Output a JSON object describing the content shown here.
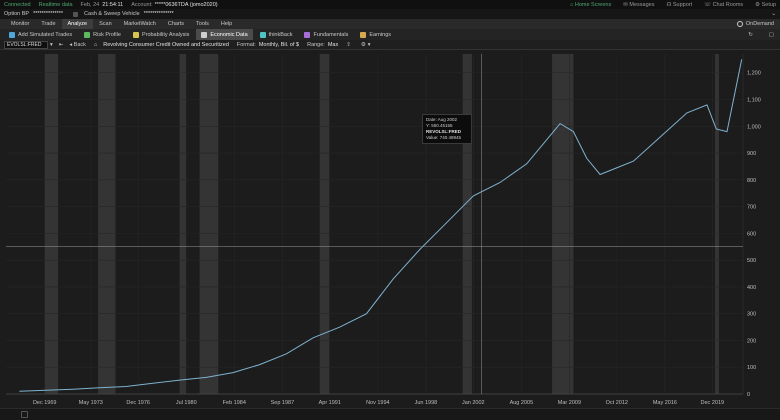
{
  "status_bar": {
    "connected": "Connected",
    "realtime": "Realtime data",
    "date": "Feb, 24",
    "time": "21:54:11",
    "account_label": "Account:",
    "account_value": "*****0636TDA (jomo2020)",
    "home_screens": "Home Screens",
    "messages": "Messages",
    "support": "Support",
    "chat_rooms": "Chat Rooms",
    "setup": "Setup"
  },
  "balance_bar": {
    "option_bp": "Option BP",
    "option_bp_value": "**************",
    "cash_sweep": "Cash & Sweep Vehicle",
    "cash_sweep_value": "**************"
  },
  "main_tabs": [
    "Monitor",
    "Trade",
    "Analyze",
    "Scan",
    "MarketWatch",
    "Charts",
    "Tools",
    "Help"
  ],
  "active_main_tab": 2,
  "ondemand": "OnDemand",
  "sub_tabs": [
    {
      "label": "Add Simulated Trades",
      "icon": "plus-icon",
      "color": "#4fa6d8"
    },
    {
      "label": "Risk Profile",
      "icon": "risk-profile-icon",
      "color": "#5fb85f"
    },
    {
      "label": "Probability Analysis",
      "icon": "probability-icon",
      "color": "#d8c44f"
    },
    {
      "label": "Economic Data",
      "icon": "economic-data-icon",
      "color": "#cfcfcf"
    },
    {
      "label": "thinkBack",
      "icon": "thinkback-icon",
      "color": "#4fc2c2"
    },
    {
      "label": "Fundamentals",
      "icon": "fundamentals-icon",
      "color": "#a66fd8"
    },
    {
      "label": "Earnings",
      "icon": "earnings-icon",
      "color": "#d8a84f"
    }
  ],
  "active_sub_tab": 3,
  "chart_toolbar": {
    "symbol": "EVOLSL:FRED",
    "back": "Back",
    "title": "Revolving Consumer Credit Owned and Securitized",
    "format_label": "Format:",
    "format_value": "Monthly, Bil. of $",
    "range_label": "Range:",
    "range_value": "Max"
  },
  "tooltip": {
    "date_label": "Date:",
    "date_value": "Aug 2002",
    "y_label": "Y:",
    "y_value": "550.45155",
    "series": "REVOLSL:FRED",
    "value_label": "Value:",
    "value_value": "740.48945"
  },
  "chart_data": {
    "type": "line",
    "x_tick_labels": [
      "Dec 1969",
      "May 1973",
      "Dec 1976",
      "Jul 1980",
      "Feb 1984",
      "Sep 1987",
      "Apr 1991",
      "Nov 1994",
      "Jun 1998",
      "Jan 2002",
      "Aug 2005",
      "Mar 2009",
      "Oct 2012",
      "May 2016",
      "Dec 2019"
    ],
    "x_tick_years": [
      1969.9,
      1973.35,
      1976.9,
      1980.5,
      1984.1,
      1987.7,
      1991.25,
      1994.85,
      1998.45,
      2002.0,
      2005.6,
      2009.2,
      2012.75,
      2016.35,
      2019.9
    ],
    "y_ticks": [
      0,
      100,
      200,
      300,
      400,
      500,
      600,
      700,
      800,
      900,
      1000,
      1100,
      1200
    ],
    "y_tick_labels": [
      "0",
      "100",
      "200",
      "300",
      "400",
      "500",
      "600",
      "700",
      "800",
      "900",
      "1,000",
      "1,100",
      "1,200"
    ],
    "xlim": [
      1967.0,
      2022.2
    ],
    "ylim": [
      0,
      1270
    ],
    "series_color": "#7fb2cf",
    "points": [
      [
        1968.0,
        10
      ],
      [
        1970,
        14
      ],
      [
        1972,
        18
      ],
      [
        1974,
        23
      ],
      [
        1976,
        28
      ],
      [
        1978,
        40
      ],
      [
        1980,
        52
      ],
      [
        1982,
        62
      ],
      [
        1984,
        80
      ],
      [
        1986,
        110
      ],
      [
        1988,
        150
      ],
      [
        1990,
        210
      ],
      [
        1992,
        250
      ],
      [
        1994,
        300
      ],
      [
        1996,
        430
      ],
      [
        1998,
        540
      ],
      [
        2000,
        640
      ],
      [
        2002,
        740
      ],
      [
        2004,
        790
      ],
      [
        2006,
        860
      ],
      [
        2007,
        920
      ],
      [
        2008.5,
        1010
      ],
      [
        2009.5,
        980
      ],
      [
        2010.5,
        880
      ],
      [
        2011.5,
        820
      ],
      [
        2012.5,
        840
      ],
      [
        2014,
        870
      ],
      [
        2016,
        960
      ],
      [
        2018,
        1050
      ],
      [
        2019.5,
        1080
      ],
      [
        2020.2,
        990
      ],
      [
        2021,
        980
      ],
      [
        2022.1,
        1250
      ]
    ],
    "recessions": [
      [
        1969.9,
        1970.9
      ],
      [
        1973.9,
        1975.2
      ],
      [
        1980.0,
        1980.5
      ],
      [
        1981.5,
        1982.9
      ],
      [
        1990.5,
        1991.2
      ],
      [
        2001.2,
        2001.9
      ],
      [
        2007.9,
        2009.5
      ],
      [
        2020.1,
        2020.4
      ]
    ],
    "crosshair": {
      "x": 2002.6,
      "y": 550.45155
    }
  }
}
